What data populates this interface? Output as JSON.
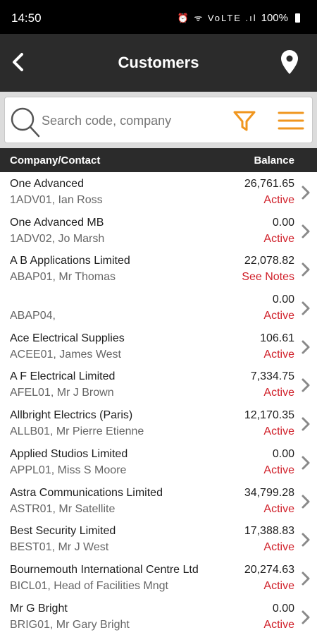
{
  "status_bar": {
    "time": "14:50",
    "icons": "⏰ ᯤ VoLTE .ıl",
    "battery": "100%"
  },
  "app_bar": {
    "title": "Customers",
    "back_icon": "chevron-left-icon",
    "location_icon": "location-pin-icon"
  },
  "search": {
    "placeholder": "Search code, company",
    "value": "",
    "filter_icon": "filter-icon",
    "menu_icon": "hamburger-menu-icon"
  },
  "list_header": {
    "company": "Company/Contact",
    "balance": "Balance"
  },
  "colors": {
    "app_bar": "#2b2b2b",
    "accent": "#f0961e",
    "status_red": "#d0202a"
  },
  "customers": [
    {
      "company": "One Advanced",
      "contact": "1ADV01, Ian Ross",
      "balance": "26,761.65",
      "status": "Active"
    },
    {
      "company": "One Advanced MB",
      "contact": "1ADV02, Jo Marsh",
      "balance": "0.00",
      "status": "Active"
    },
    {
      "company": "A B Applications Limited",
      "contact": "ABAP01, Mr Thomas",
      "balance": "22,078.82",
      "status": "See Notes"
    },
    {
      "company": "",
      "contact": "ABAP04,",
      "balance": "0.00",
      "status": "Active"
    },
    {
      "company": "Ace Electrical Supplies",
      "contact": "ACEE01, James West",
      "balance": "106.61",
      "status": "Active"
    },
    {
      "company": "A F Electrical Limited",
      "contact": "AFEL01, Mr J Brown",
      "balance": "7,334.75",
      "status": "Active"
    },
    {
      "company": "Allbright Electrics (Paris)",
      "contact": "ALLB01, Mr Pierre Etienne",
      "balance": "12,170.35",
      "status": "Active"
    },
    {
      "company": "Applied Studios Limited",
      "contact": "APPL01, Miss S Moore",
      "balance": "0.00",
      "status": "Active"
    },
    {
      "company": "Astra Communications Limited",
      "contact": "ASTR01, Mr Satellite",
      "balance": "34,799.28",
      "status": "Active"
    },
    {
      "company": "Best Security Limited",
      "contact": "BEST01, Mr J  West",
      "balance": "17,388.83",
      "status": "Active"
    },
    {
      "company": "Bournemouth International Centre Ltd",
      "contact": "BICL01, Head of Facilities Mngt",
      "balance": "20,274.63",
      "status": "Active"
    },
    {
      "company": "Mr G Bright",
      "contact": "BRIG01, Mr Gary Bright",
      "balance": "0.00",
      "status": "Active"
    }
  ]
}
